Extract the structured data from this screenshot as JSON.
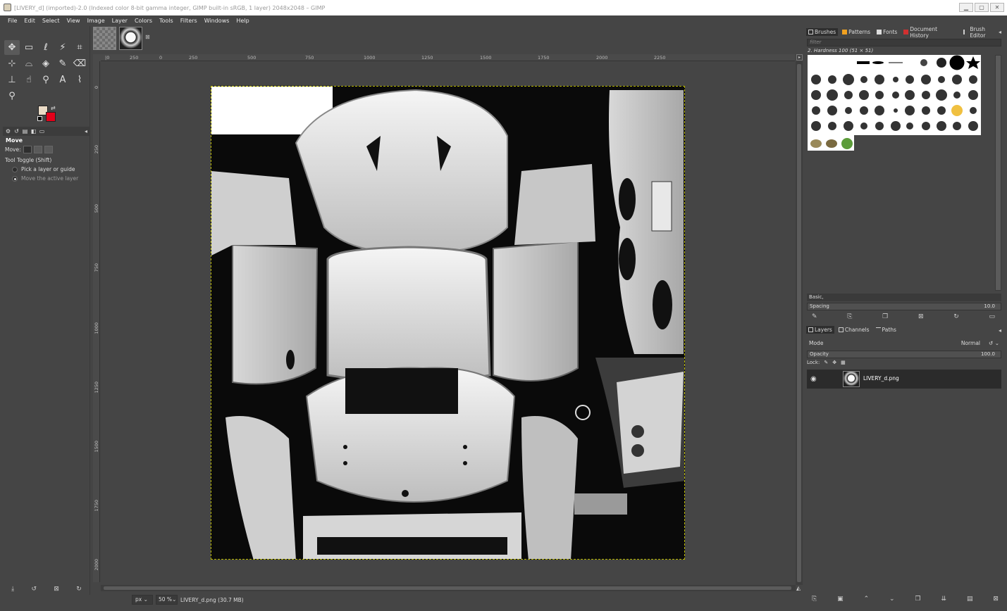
{
  "window": {
    "title": "[LIVERY_d] (imported)-2.0 (Indexed color 8-bit gamma integer, GIMP built-in sRGB, 1 layer) 2048x2048 – GIMP",
    "minimize": "▁",
    "maximize": "▢",
    "close": "✕"
  },
  "menu": [
    "File",
    "Edit",
    "Select",
    "View",
    "Image",
    "Layer",
    "Colors",
    "Tools",
    "Filters",
    "Windows",
    "Help"
  ],
  "toolbox": {
    "tools": [
      {
        "name": "move-tool",
        "glyph": "✥"
      },
      {
        "name": "rect-select-tool",
        "glyph": "▭"
      },
      {
        "name": "lasso-tool",
        "glyph": "ℓ"
      },
      {
        "name": "fuzzy-select-tool",
        "glyph": "⚡"
      },
      {
        "name": "crop-tool",
        "glyph": "⌗"
      },
      {
        "name": "unified-transform-tool",
        "glyph": "⊹"
      },
      {
        "name": "warp-transform-tool",
        "glyph": "⌓"
      },
      {
        "name": "bucket-fill-tool",
        "glyph": "◈"
      },
      {
        "name": "paintbrush-tool",
        "glyph": "✎"
      },
      {
        "name": "eraser-tool",
        "glyph": "⌫"
      },
      {
        "name": "clone-tool",
        "glyph": "⊥"
      },
      {
        "name": "smudge-tool",
        "glyph": "☝"
      },
      {
        "name": "paths-tool",
        "glyph": "⚲"
      },
      {
        "name": "text-tool",
        "glyph": "A"
      },
      {
        "name": "color-picker-tool",
        "glyph": "⌇"
      },
      {
        "name": "zoom-tool",
        "glyph": "⚲"
      }
    ],
    "colors": {
      "foreground": "#eadbc6",
      "background": "#e4001a"
    }
  },
  "tool_options": {
    "title": "Move",
    "move_label": "Move:",
    "toggle_label": "Tool Toggle  (Shift)",
    "option1": "Pick a layer or guide",
    "option2": "Move the active layer",
    "selected": "Move the active layer"
  },
  "image_tabs": {
    "close": "⊠"
  },
  "ruler": {
    "top": [
      "|0",
      "250",
      "0",
      "250",
      "500",
      "750",
      "1000",
      "1250",
      "1500",
      "1750",
      "2000",
      "2250"
    ],
    "left": [
      "0",
      "250",
      "500",
      "750",
      "1000",
      "1250",
      "1500",
      "1750",
      "2000"
    ]
  },
  "status": {
    "unit": "px",
    "zoom": "50 %",
    "file": "LIVERY_d.png (30.7 MB)"
  },
  "brushes": {
    "tabs": [
      "Brushes",
      "Patterns",
      "Fonts",
      "Document History",
      "Brush Editor"
    ],
    "filter_placeholder": "filter",
    "current_brush": "2. Hardness 100 (51 × 51)",
    "preset": "Basic,",
    "spacing_label": "Spacing",
    "spacing_value": "10.0"
  },
  "layers": {
    "tabs": [
      "Layers",
      "Channels",
      "Paths"
    ],
    "mode_label": "Mode",
    "mode_value": "Normal",
    "opacity_label": "Opacity",
    "opacity_value": "100.0",
    "lock_label": "Lock:",
    "layer_name": "LIVERY_d.png"
  }
}
